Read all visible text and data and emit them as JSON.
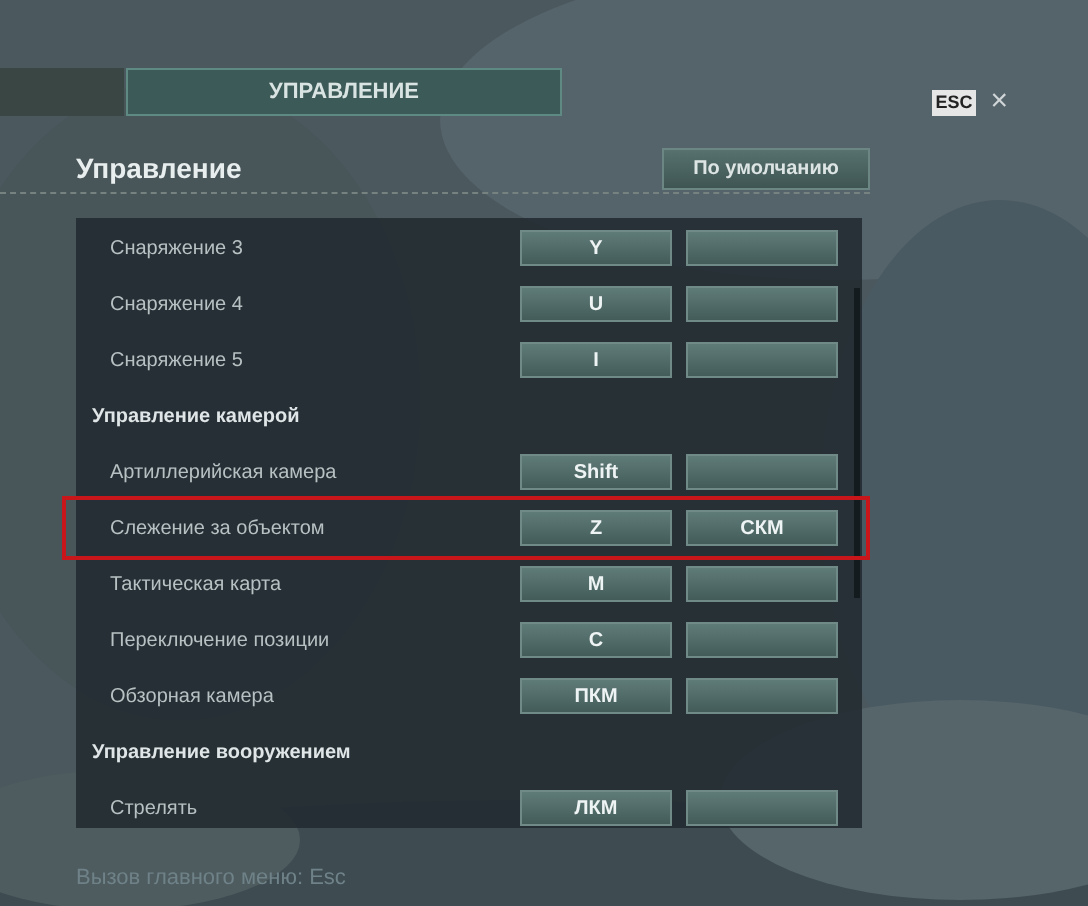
{
  "tabs": [
    {
      "label": "УПРАВЛЕНИЕ",
      "selected": true
    }
  ],
  "close": {
    "key": "ESC",
    "icon": "×"
  },
  "heading": "Управление",
  "default_button": "По умолчанию",
  "rows": [
    {
      "kind": "binding",
      "label": "Снаряжение 3",
      "keys": [
        "Y"
      ],
      "highlighted": false
    },
    {
      "kind": "binding",
      "label": "Снаряжение 4",
      "keys": [
        "U"
      ],
      "highlighted": false
    },
    {
      "kind": "binding",
      "label": "Снаряжение 5",
      "keys": [
        "I"
      ],
      "highlighted": false
    },
    {
      "kind": "section",
      "label": "Управление камерой"
    },
    {
      "kind": "binding",
      "label": "Артиллерийская камера",
      "keys": [
        "Shift"
      ],
      "highlighted": false
    },
    {
      "kind": "binding",
      "label": "Слежение за объектом",
      "keys": [
        "Z",
        "СКМ"
      ],
      "highlighted": true
    },
    {
      "kind": "binding",
      "label": "Тактическая карта",
      "keys": [
        "M"
      ],
      "highlighted": false
    },
    {
      "kind": "binding",
      "label": "Переключение позиции",
      "keys": [
        "C"
      ],
      "highlighted": false
    },
    {
      "kind": "binding",
      "label": "Обзорная камера",
      "keys": [
        "ПКМ"
      ],
      "highlighted": false
    },
    {
      "kind": "section",
      "label": "Управление вооружением"
    },
    {
      "kind": "binding",
      "label": "Стрелять",
      "keys": [
        "ЛКМ"
      ],
      "highlighted": false
    }
  ],
  "footer": "Вызов главного меню: Esc"
}
